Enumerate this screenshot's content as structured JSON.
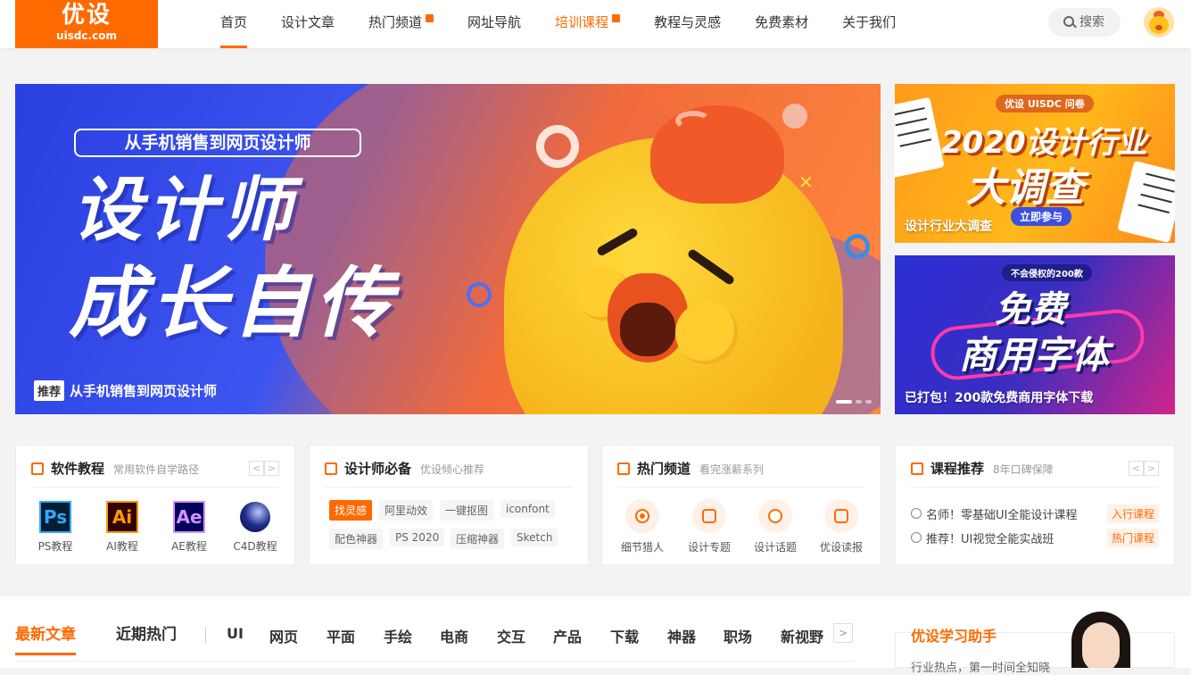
{
  "logo": {
    "cn": "优设",
    "en": "uisdc.com"
  },
  "nav": [
    {
      "label": "首页",
      "active": true
    },
    {
      "label": "设计文章"
    },
    {
      "label": "热门频道",
      "hot": true
    },
    {
      "label": "网址导航"
    },
    {
      "label": "培训课程",
      "hot": true,
      "orange": true
    },
    {
      "label": "教程与灵感"
    },
    {
      "label": "免费素材"
    },
    {
      "label": "关于我们"
    }
  ],
  "search": {
    "label": "搜索"
  },
  "hero": {
    "subtitle": "从手机销售到网页设计师",
    "line1": "设计师",
    "line2": "成长自传",
    "badge": "推荐",
    "caption": "从手机销售到网页设计师"
  },
  "side_banners": [
    {
      "pill": "优设 UISDC 问卷",
      "line1": "2020设计行业",
      "line2": "大调查",
      "button": "立即参与",
      "caption": "设计行业大调查"
    },
    {
      "pill": "不会侵权的200款",
      "line1": "免费",
      "line2": "商用字体",
      "caption": "已打包！200款免费商用字体下载"
    }
  ],
  "cards": {
    "software": {
      "title": "软件教程",
      "sub": "常用软件自学路径",
      "items": [
        {
          "abbr": "Ps",
          "label": "PS教程"
        },
        {
          "abbr": "Ai",
          "label": "AI教程"
        },
        {
          "abbr": "Ae",
          "label": "AE教程"
        },
        {
          "abbr": "",
          "label": "C4D教程"
        }
      ]
    },
    "essentials": {
      "title": "设计师必备",
      "sub": "优设倾心推荐",
      "tags": [
        "找灵感",
        "阿里动效",
        "一键抠图",
        "iconfont",
        "配色神器",
        "PS 2020",
        "压缩神器",
        "Sketch"
      ]
    },
    "hot": {
      "title": "热门频道",
      "sub": "看完涨薪系列",
      "items": [
        "细节猎人",
        "设计专题",
        "设计话题",
        "优设读报"
      ]
    },
    "courses": {
      "title": "课程推荐",
      "sub": "8年口碑保障",
      "rows": [
        {
          "text": "名师！零基础UI全能设计课程",
          "tag": "入行课程"
        },
        {
          "text": "推荐！UI视觉全能实战班",
          "tag": "热门课程"
        }
      ]
    }
  },
  "bottom": {
    "tabs": [
      "最新文章",
      "近期热门"
    ],
    "categories": [
      "UI",
      "网页",
      "平面",
      "手绘",
      "电商",
      "交互",
      "产品",
      "下载",
      "神器",
      "职场",
      "新视野"
    ],
    "assistant_title": "优设学习助手",
    "assistant_sub": "行业热点，第一时间全知晓"
  },
  "colors": {
    "accent": "#ff6a00"
  }
}
